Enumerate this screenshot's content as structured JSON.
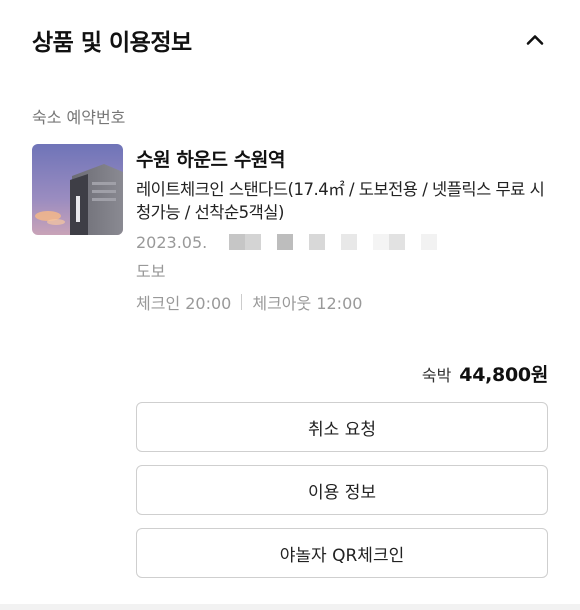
{
  "section": {
    "title": "상품 및 이용정보",
    "collapse_icon": "chevron-up-icon"
  },
  "reservation": {
    "label": "숙소 예약번호"
  },
  "product": {
    "hotel_name": "수원 하운드 수원역",
    "room_name": "레이트체크인 스탠다드(17.4㎡ / 도보전용 / 넷플릭스 무료 시청가능 / 선착순5객실)",
    "date": "2023.05.",
    "stay_type": "도보",
    "checkin": "체크인 20:00",
    "checkout": "체크아웃 12:00"
  },
  "price": {
    "label": "숙박",
    "value": "44,800원"
  },
  "actions": {
    "cancel": "취소 요청",
    "usage_info": "이용 정보",
    "qr_checkin": "야놀자 QR체크인"
  }
}
